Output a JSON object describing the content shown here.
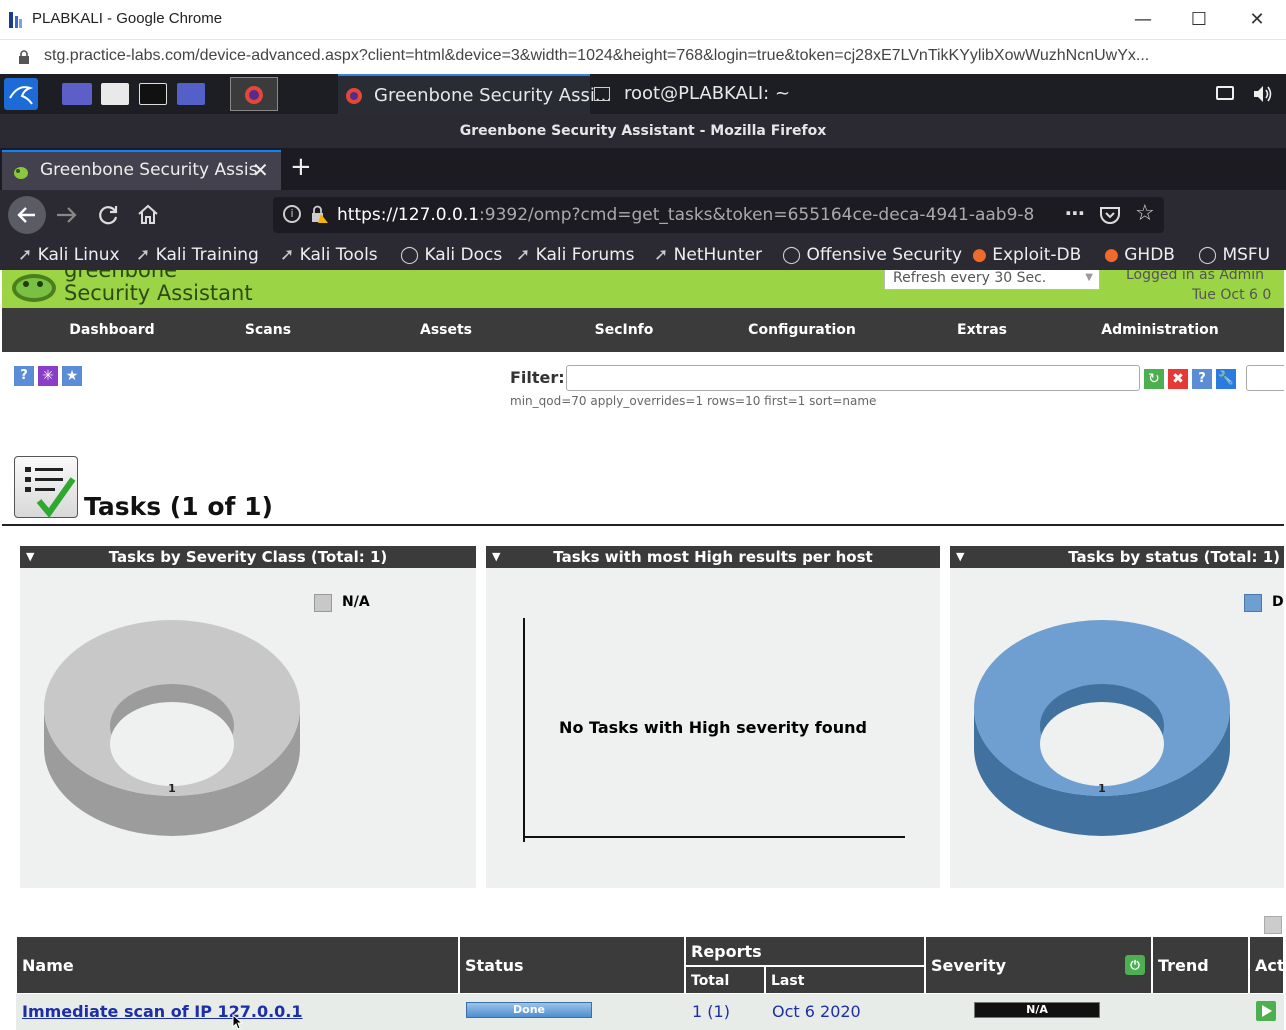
{
  "chrome": {
    "window_title": "PLABKALI - Google Chrome",
    "url": "stg.practice-labs.com/device-advanced.aspx?client=html&device=3&width=1024&height=768&login=true&token=cj28xE7LVnTikKYylibXowWuzhNcnUwYx..."
  },
  "kali_taskbar": {
    "task_firefox": "Greenbone Security Assi...",
    "task_terminal": "root@PLABKALI: ~"
  },
  "firefox": {
    "window_title": "Greenbone Security Assistant - Mozilla Firefox",
    "tab_title": "Greenbone Security Assis",
    "url_host": "https://127.0.0.1",
    "url_rest": ":9392/omp?cmd=get_tasks&token=655164ce-deca-4941-aab9-8",
    "bookmarks": [
      "Kali Linux",
      "Kali Training",
      "Kali Tools",
      "Kali Docs",
      "Kali Forums",
      "NetHunter",
      "Offensive Security",
      "Exploit-DB",
      "GHDB",
      "MSFU"
    ]
  },
  "gsa": {
    "logo_line1": "greenbone",
    "logo_line2": "Security Assistant",
    "refresh_select": "Refresh every 30 Sec.",
    "logged_in": "Logged in as  Admin",
    "date": "Tue Oct 6 0",
    "nav": [
      "Dashboard",
      "Scans",
      "Assets",
      "SecInfo",
      "Configuration",
      "Extras",
      "Administration"
    ],
    "filter_label": "Filter:",
    "filter_value": "",
    "filter_hint": "min_qod=70 apply_overrides=1 rows=10 first=1 sort=name",
    "page_title": "Tasks (1 of 1)"
  },
  "panels": {
    "severity": {
      "title": "Tasks by Severity Class (Total: 1)",
      "legend": "N/A",
      "slice_label": "1",
      "color": "#c8c8c8"
    },
    "high": {
      "title": "Tasks with most High results per host",
      "message": "No Tasks with High severity found"
    },
    "status": {
      "title": "Tasks by status (Total: 1)",
      "legend": "D",
      "slice_label": "1",
      "color": "#6f9fd0"
    }
  },
  "table": {
    "headers": {
      "name": "Name",
      "status": "Status",
      "reports": "Reports",
      "total": "Total",
      "last": "Last",
      "severity": "Severity",
      "trend": "Trend",
      "actions": "Act"
    },
    "rows": [
      {
        "name": "Immediate scan of IP 127.0.0.1",
        "status": "Done",
        "total": "1",
        "total_paren": "(1)",
        "last": "Oct 6 2020",
        "severity": "N/A"
      }
    ]
  }
}
